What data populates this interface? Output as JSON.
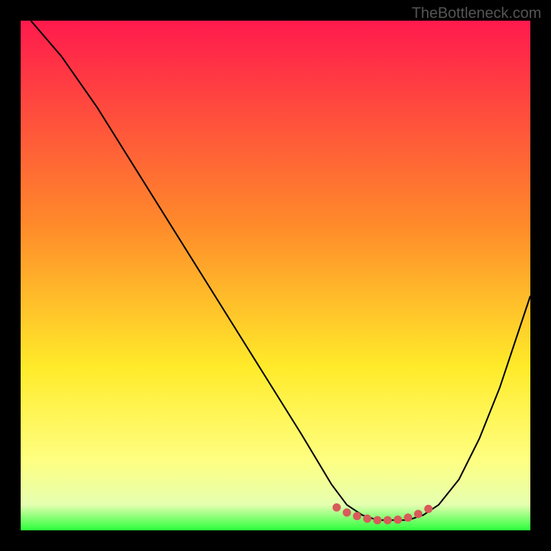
{
  "watermark": "TheBottleneck.com",
  "chart_data": {
    "type": "line",
    "title": "",
    "xlabel": "",
    "ylabel": "",
    "xlim": [
      0,
      100
    ],
    "ylim": [
      0,
      100
    ],
    "background_gradient": {
      "stops": [
        {
          "offset": 0,
          "color": "#ff1a4d"
        },
        {
          "offset": 40,
          "color": "#ff8a2a"
        },
        {
          "offset": 68,
          "color": "#ffeb2a"
        },
        {
          "offset": 86,
          "color": "#ffff80"
        },
        {
          "offset": 95,
          "color": "#e5ffb0"
        },
        {
          "offset": 100,
          "color": "#2cff3a"
        }
      ]
    },
    "series": [
      {
        "name": "curve",
        "color": "#000000",
        "x": [
          2,
          8,
          15,
          25,
          35,
          45,
          55,
          61,
          64,
          67,
          70,
          73,
          76,
          79,
          82,
          86,
          90,
          94,
          98,
          100
        ],
        "y": [
          100,
          93,
          83,
          67,
          51,
          35,
          19,
          9,
          5,
          3,
          2,
          2,
          2,
          3,
          5,
          10,
          18,
          28,
          40,
          46
        ]
      }
    ],
    "highlight_points": {
      "name": "minimum-region",
      "color": "#d85a5a",
      "x": [
        62,
        64,
        66,
        68,
        70,
        72,
        74,
        76,
        78,
        80
      ],
      "y": [
        4.5,
        3.5,
        2.8,
        2.3,
        2.0,
        2.0,
        2.1,
        2.5,
        3.2,
        4.2
      ]
    }
  }
}
